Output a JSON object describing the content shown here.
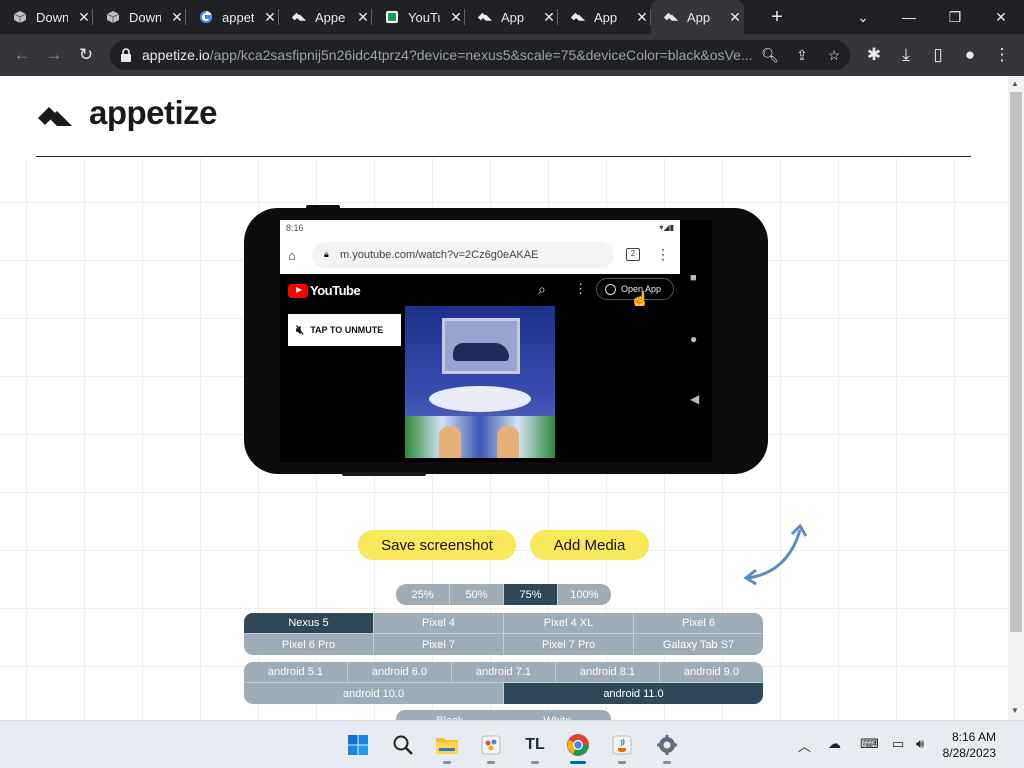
{
  "browser": {
    "tabs": [
      {
        "title": "Down",
        "icon": "cube-icon"
      },
      {
        "title": "Down",
        "icon": "cube-icon"
      },
      {
        "title": "appet",
        "icon": "google-icon"
      },
      {
        "title": "Appe",
        "icon": "appetize-icon"
      },
      {
        "title": "YouTu",
        "icon": "youtube-icon"
      },
      {
        "title": "App",
        "icon": "appetize-icon"
      },
      {
        "title": "App",
        "icon": "appetize-icon"
      },
      {
        "title": "App",
        "icon": "appetize-icon",
        "active": true
      }
    ],
    "url_host": "appetize.io",
    "url_rest": "/app/kca2sasfipnij5n26idc4tprz4?device=nexus5&scale=75&deviceColor=black&osVe..."
  },
  "page": {
    "logo_text": "appetize",
    "brand_color": "#1a1a1a"
  },
  "device": {
    "status_time": "8:16",
    "mobile_url": "m.youtube.com/watch?v=2Cz6g0eAKAE",
    "tab_count": "2",
    "yt_brand": "YouTube",
    "open_app_label": "Open App",
    "unmute_label": "TAP TO UNMUTE"
  },
  "controls": {
    "save_screenshot": "Save screenshot",
    "add_media": "Add Media",
    "zoom": {
      "options": [
        "25%",
        "50%",
        "75%",
        "100%"
      ],
      "selected": "75%"
    },
    "devices": {
      "rows": [
        [
          "Nexus 5",
          "Pixel 4",
          "Pixel 4 XL",
          "Pixel 6"
        ],
        [
          "Pixel 6 Pro",
          "Pixel 7",
          "Pixel 7 Pro",
          "Galaxy Tab S7"
        ]
      ],
      "selected": "Nexus 5"
    },
    "os_versions": {
      "rows": [
        [
          "android 5.1",
          "android 6.0",
          "android 7.1",
          "android 8.1",
          "android 9.0"
        ],
        [
          "android 10.0",
          "android 11.0"
        ]
      ],
      "selected": "android 11.0"
    },
    "device_colors": {
      "options": [
        "Black",
        "White"
      ],
      "selected": "Black"
    },
    "selected_color": "#2f4858",
    "button_color": "#f8e85a"
  },
  "taskbar": {
    "apps": [
      "windows-start-icon",
      "search-icon",
      "file-explorer-icon",
      "paint-icon",
      "tl-app-icon",
      "chrome-icon",
      "java-icon",
      "settings-icon"
    ],
    "tl_label": "TL",
    "time": "8:16 AM",
    "date": "8/28/2023"
  }
}
